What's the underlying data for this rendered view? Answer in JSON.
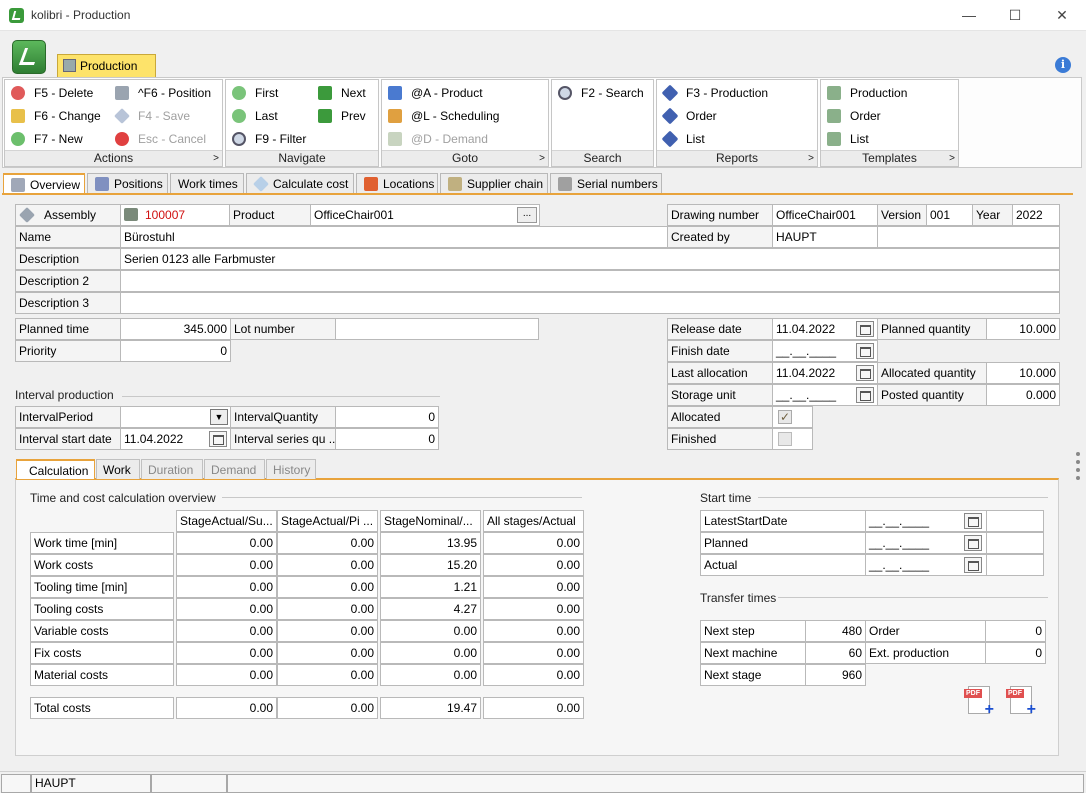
{
  "window": {
    "title": "kolibri - Production",
    "min": "—",
    "max": "☐",
    "close": "✕"
  },
  "ribbon": {
    "tab": "Production",
    "info": "i",
    "groups": {
      "actions": {
        "name": "Actions",
        "items": [
          "F5 - Delete",
          "F6 - Change",
          "F7 - New",
          "^F6 - Position",
          "F4 - Save",
          "Esc - Cancel"
        ]
      },
      "navigate": {
        "name": "Navigate",
        "items": [
          "First",
          "Last",
          "F9 - Filter",
          "Next",
          "Prev"
        ]
      },
      "goto": {
        "name": "Goto",
        "items": [
          "@A - Product",
          "@L - Scheduling",
          "@D - Demand"
        ]
      },
      "search": {
        "name": "Search",
        "items": [
          "F2 - Search"
        ]
      },
      "reports": {
        "name": "Reports",
        "items": [
          "F3 - Production",
          "Order",
          "List"
        ]
      },
      "templates": {
        "name": "Templates",
        "items": [
          "Production",
          "Order",
          "List"
        ]
      }
    }
  },
  "tabs": [
    "Overview",
    "Positions",
    "Work times",
    "Calculate cost",
    "Locations",
    "Supplier chain",
    "Serial numbers"
  ],
  "header": {
    "assembly_label": "Assembly",
    "assembly_value": "100007",
    "product_label": "Product",
    "product_value": "OfficeChair001",
    "browse": "...",
    "drawing_label": "Drawing number",
    "drawing_value": "OfficeChair001",
    "version_label": "Version",
    "version_value": "001",
    "year_label": "Year",
    "year_value": "2022",
    "name_label": "Name",
    "name_value": "Bürostuhl",
    "createdby_label": "Created by",
    "createdby_value": "HAUPT",
    "desc_label": "Description",
    "desc_value": "Serien 0123 alle Farbmuster",
    "desc2_label": "Description 2",
    "desc2_value": "",
    "desc3_label": "Description 3",
    "desc3_value": ""
  },
  "planning": {
    "planned_time_label": "Planned time",
    "planned_time_value": "345.000",
    "lot_label": "Lot number",
    "lot_value": "",
    "priority_label": "Priority",
    "priority_value": "0",
    "release_label": "Release date",
    "release_value": "11.04.2022",
    "finish_label": "Finish date",
    "finish_value": "__.__.____",
    "lastalloc_label": "Last allocation",
    "lastalloc_value": "11.04.2022",
    "storage_label": "Storage unit",
    "storage_value": "__.__.____",
    "planned_qty_label": "Planned quantity",
    "planned_qty_value": "10.000",
    "alloc_qty_label": "Allocated quantity",
    "alloc_qty_value": "10.000",
    "posted_qty_label": "Posted quantity",
    "posted_qty_value": "0.000",
    "allocated_label": "Allocated",
    "finished_label": "Finished"
  },
  "interval": {
    "title": "Interval production",
    "period_label": "IntervalPeriod",
    "period_value": "",
    "qty_label": "IntervalQuantity",
    "qty_value": "0",
    "start_label": "Interval start date",
    "start_value": "11.04.2022",
    "series_label": "Interval series qu ...",
    "series_value": "0"
  },
  "inner_tabs": [
    "Calculation",
    "Work",
    "Duration",
    "Demand",
    "History"
  ],
  "calc": {
    "title": "Time and cost calculation overview",
    "columns": [
      "StageActual/Su...",
      "StageActual/Pi ...",
      "StageNominal/...",
      "All stages/Actual"
    ],
    "rows": [
      {
        "label": "Work time [min]",
        "values": [
          "0.00",
          "0.00",
          "13.95",
          "0.00"
        ]
      },
      {
        "label": "Work costs",
        "values": [
          "0.00",
          "0.00",
          "15.20",
          "0.00"
        ]
      },
      {
        "label": "Tooling time [min]",
        "values": [
          "0.00",
          "0.00",
          "1.21",
          "0.00"
        ]
      },
      {
        "label": "Tooling costs",
        "values": [
          "0.00",
          "0.00",
          "4.27",
          "0.00"
        ]
      },
      {
        "label": "Variable costs",
        "values": [
          "0.00",
          "0.00",
          "0.00",
          "0.00"
        ]
      },
      {
        "label": "Fix costs",
        "values": [
          "0.00",
          "0.00",
          "0.00",
          "0.00"
        ]
      },
      {
        "label": "Material costs",
        "values": [
          "0.00",
          "0.00",
          "0.00",
          "0.00"
        ]
      }
    ],
    "total": {
      "label": "Total costs",
      "values": [
        "0.00",
        "0.00",
        "19.47",
        "0.00"
      ]
    }
  },
  "start_time": {
    "title": "Start time",
    "rows": [
      {
        "label": "LatestStartDate",
        "value": "__.__.____"
      },
      {
        "label": "Planned",
        "value": "__.__.____"
      },
      {
        "label": "Actual",
        "value": "__.__.____"
      }
    ]
  },
  "transfer": {
    "title": "Transfer times",
    "next_step_label": "Next step",
    "next_step_value": "480",
    "order_label": "Order",
    "order_value": "0",
    "next_machine_label": "Next machine",
    "next_machine_value": "60",
    "ext_label": "Ext. production",
    "ext_value": "0",
    "next_stage_label": "Next stage",
    "next_stage_value": "960",
    "pdf": "PDF"
  },
  "status": {
    "user": "HAUPT"
  }
}
